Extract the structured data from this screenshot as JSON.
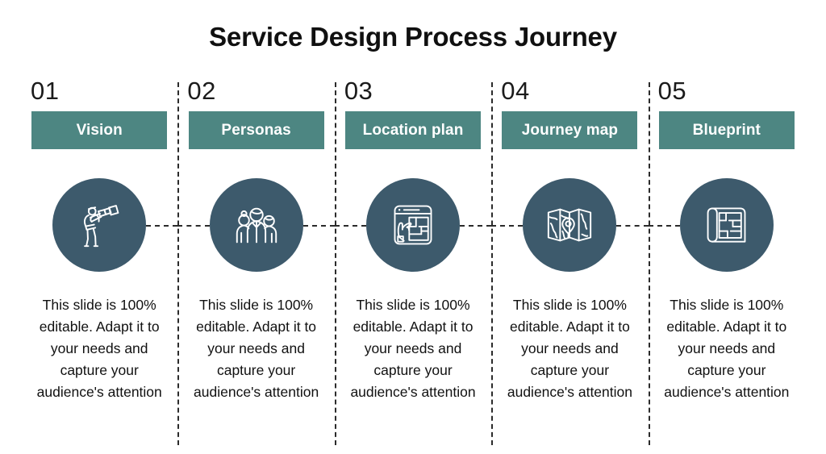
{
  "header": {
    "title": "Service Design Process Journey"
  },
  "theme": {
    "background": "#ffffff",
    "label_bar_color": "#4d8682",
    "label_text_color": "#ffffff",
    "icon_circle_color": "#3d5a6c",
    "icon_stroke_color": "#ffffff",
    "number_color": "#1b1b1b",
    "body_text_color": "#111111",
    "divider_color": "#2b2b2b"
  },
  "steps": [
    {
      "number": "01",
      "label": "Vision",
      "icon": "person-with-telescope-icon",
      "body": "This slide is 100% editable. Adapt it to your needs and capture your audience's attention"
    },
    {
      "number": "02",
      "label": "Personas",
      "icon": "group-of-people-icon",
      "body": "This slide is 100% editable. Adapt it to your needs and capture your audience's attention"
    },
    {
      "number": "03",
      "label": "Location plan",
      "icon": "hand-pointing-at-floor-plan-icon",
      "body": "This slide is 100% editable. Adapt it to your needs and capture your audience's attention"
    },
    {
      "number": "04",
      "label": "Journey map",
      "icon": "folded-map-with-pin-icon",
      "body": "This slide is 100% editable. Adapt it to your needs and capture your audience's attention"
    },
    {
      "number": "05",
      "label": "Blueprint",
      "icon": "rolled-blueprint-icon",
      "body": "This slide is 100% editable. Adapt it to your needs and capture your audience's attention"
    }
  ]
}
